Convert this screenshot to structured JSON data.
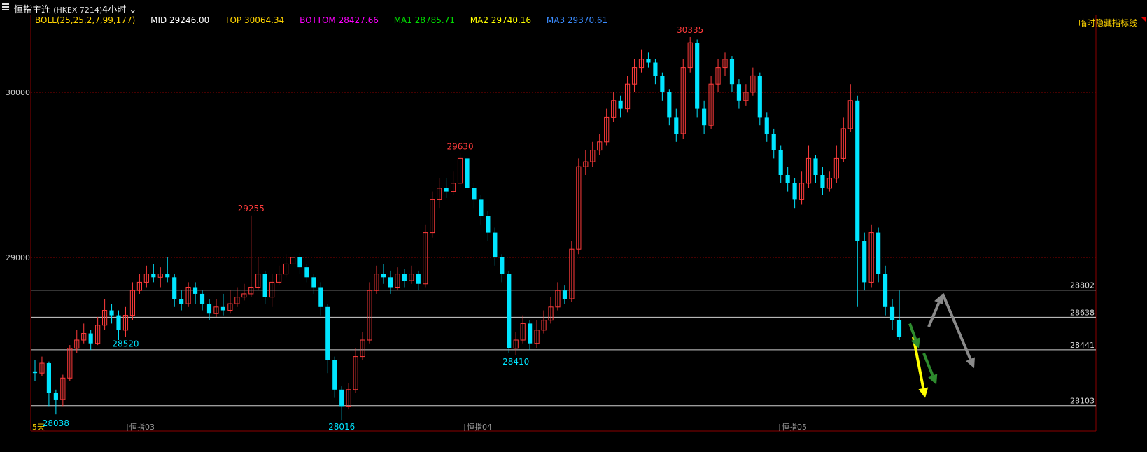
{
  "header": {
    "title": "恒指主连",
    "code": "(HKEX 7214)",
    "period": "4小时"
  },
  "indicator": {
    "boll": "BOLL(25,25,2,7,99,177)",
    "mid": "MID 29246.00",
    "top": "TOP 30064.34",
    "bottom": "BOTTOM 28427.66",
    "ma1": "MA1 28785.71",
    "ma2": "MA2 29740.16",
    "ma3": "MA3 29370.61",
    "hide_label": "临时隐藏指标线",
    "colors": {
      "boll": "#ffd400",
      "mid": "#ffffff",
      "top": "#ffd400",
      "bottom": "#ff00ff",
      "ma1": "#00e000",
      "ma2": "#ffff00",
      "ma3": "#3a8cff"
    }
  },
  "chart_data": {
    "type": "candlestick",
    "y_ticks": [
      29000,
      30000
    ],
    "ylim": [
      28000,
      30450
    ],
    "x_labels": [
      "恒指03",
      "恒指04",
      "恒指05"
    ],
    "bottom_left_label": "5天",
    "grid": "dotted red at y ticks",
    "colors": {
      "up": "#ff3b3b",
      "down": "#00e5ff",
      "grid": "#8b0000",
      "level": "#d0d0d0"
    },
    "annotations": [
      {
        "text": "28038",
        "value": 28038,
        "color": "#00e5ff"
      },
      {
        "text": "29255",
        "value": 29255,
        "color": "#ff3b3b"
      },
      {
        "text": "28016",
        "value": 28016,
        "color": "#00e5ff"
      },
      {
        "text": "29630",
        "value": 29630,
        "color": "#ff3b3b"
      },
      {
        "text": "28410",
        "value": 28410,
        "color": "#00e5ff"
      },
      {
        "text": "30335",
        "value": 30335,
        "color": "#ff3b3b"
      },
      {
        "text": "28520",
        "value": 28520,
        "color": "#00e5ff"
      }
    ],
    "levels": [
      {
        "label": "28802",
        "value": 28802
      },
      {
        "label": "28638",
        "value": 28638
      },
      {
        "label": "28441",
        "value": 28441
      },
      {
        "label": "28103",
        "value": 28103
      }
    ],
    "forecast_arrows": [
      {
        "color": "#ffff00",
        "from": 28520,
        "to": 28150
      },
      {
        "color": "#2e8b2e",
        "from": 28600,
        "to": 28450
      },
      {
        "color": "#2e8b2e",
        "from": 28420,
        "to": 28230
      },
      {
        "color": "#8a8a8a",
        "from": 28580,
        "to": 28780
      },
      {
        "color": "#8a8a8a",
        "from": 28780,
        "to": 28330
      }
    ],
    "candles": [
      [
        28310,
        28300,
        28380,
        28250
      ],
      [
        28300,
        28360,
        28400,
        28280
      ],
      [
        28360,
        28180,
        28370,
        28100
      ],
      [
        28180,
        28140,
        28200,
        28050
      ],
      [
        28140,
        28270,
        28290,
        28100
      ],
      [
        28270,
        28450,
        28470,
        28250
      ],
      [
        28450,
        28500,
        28560,
        28420
      ],
      [
        28500,
        28540,
        28600,
        28480
      ],
      [
        28540,
        28480,
        28560,
        28440
      ],
      [
        28480,
        28590,
        28640,
        28470
      ],
      [
        28590,
        28680,
        28750,
        28560
      ],
      [
        28680,
        28650,
        28720,
        28600
      ],
      [
        28650,
        28560,
        28680,
        28500
      ],
      [
        28560,
        28650,
        28700,
        28520
      ],
      [
        28650,
        28800,
        28850,
        28620
      ],
      [
        28800,
        28850,
        28900,
        28780
      ],
      [
        28850,
        28900,
        28950,
        28820
      ],
      [
        28900,
        28880,
        28960,
        28850
      ],
      [
        28880,
        28900,
        28940,
        28820
      ],
      [
        28900,
        28880,
        29000,
        28850
      ],
      [
        28880,
        28750,
        28900,
        28700
      ],
      [
        28750,
        28720,
        28800,
        28680
      ],
      [
        28720,
        28820,
        28850,
        28700
      ],
      [
        28820,
        28780,
        28850,
        28720
      ],
      [
        28780,
        28720,
        28800,
        28680
      ],
      [
        28720,
        28660,
        28750,
        28620
      ],
      [
        28660,
        28700,
        28750,
        28640
      ],
      [
        28700,
        28680,
        28780,
        28650
      ],
      [
        28680,
        28720,
        28800,
        28660
      ],
      [
        28720,
        28760,
        28820,
        28700
      ],
      [
        28760,
        28780,
        28840,
        28740
      ],
      [
        28780,
        28820,
        29255,
        28760
      ],
      [
        28820,
        28900,
        29000,
        28800
      ],
      [
        28900,
        28760,
        28920,
        28720
      ],
      [
        28760,
        28850,
        28900,
        28700
      ],
      [
        28850,
        28900,
        28950,
        28830
      ],
      [
        28900,
        28960,
        29020,
        28880
      ],
      [
        28960,
        29000,
        29060,
        28920
      ],
      [
        29000,
        28940,
        29030,
        28900
      ],
      [
        28940,
        28880,
        28960,
        28850
      ],
      [
        28880,
        28820,
        28900,
        28780
      ],
      [
        28820,
        28700,
        28850,
        28650
      ],
      [
        28700,
        28380,
        28720,
        28300
      ],
      [
        28380,
        28200,
        28400,
        28150
      ],
      [
        28200,
        28100,
        28220,
        28016
      ],
      [
        28100,
        28200,
        28240,
        28080
      ],
      [
        28200,
        28400,
        28450,
        28180
      ],
      [
        28400,
        28500,
        28550,
        28380
      ],
      [
        28500,
        28800,
        28850,
        28480
      ],
      [
        28800,
        28900,
        28950,
        28780
      ],
      [
        28900,
        28880,
        28960,
        28840
      ],
      [
        28880,
        28820,
        28920,
        28780
      ],
      [
        28820,
        28900,
        28940,
        28800
      ],
      [
        28900,
        28860,
        28930,
        28820
      ],
      [
        28860,
        28900,
        28950,
        28840
      ],
      [
        28900,
        28840,
        28920,
        28800
      ],
      [
        28840,
        29150,
        29200,
        28820
      ],
      [
        29150,
        29350,
        29400,
        29120
      ],
      [
        29350,
        29420,
        29480,
        29300
      ],
      [
        29420,
        29400,
        29480,
        29360
      ],
      [
        29400,
        29450,
        29520,
        29380
      ],
      [
        29450,
        29600,
        29630,
        29420
      ],
      [
        29600,
        29420,
        29620,
        29380
      ],
      [
        29420,
        29350,
        29450,
        29300
      ],
      [
        29350,
        29250,
        29380,
        29200
      ],
      [
        29250,
        29150,
        29280,
        29100
      ],
      [
        29150,
        29000,
        29180,
        28950
      ],
      [
        29000,
        28900,
        29020,
        28850
      ],
      [
        28900,
        28450,
        28920,
        28420
      ],
      [
        28450,
        28500,
        28550,
        28410
      ],
      [
        28500,
        28600,
        28650,
        28480
      ],
      [
        28600,
        28480,
        28620,
        28440
      ],
      [
        28480,
        28560,
        28620,
        28450
      ],
      [
        28560,
        28620,
        28680,
        28540
      ],
      [
        28620,
        28700,
        28760,
        28600
      ],
      [
        28700,
        28800,
        28850,
        28680
      ],
      [
        28800,
        28750,
        28830,
        28720
      ],
      [
        28750,
        29050,
        29100,
        28730
      ],
      [
        29050,
        29550,
        29600,
        29020
      ],
      [
        29550,
        29580,
        29650,
        29500
      ],
      [
        29580,
        29650,
        29700,
        29550
      ],
      [
        29650,
        29700,
        29750,
        29620
      ],
      [
        29700,
        29850,
        29900,
        29680
      ],
      [
        29850,
        29950,
        30000,
        29820
      ],
      [
        29950,
        29900,
        29980,
        29850
      ],
      [
        29900,
        30050,
        30100,
        29880
      ],
      [
        30050,
        30150,
        30200,
        30000
      ],
      [
        30150,
        30200,
        30260,
        30120
      ],
      [
        30200,
        30180,
        30240,
        30150
      ],
      [
        30180,
        30100,
        30200,
        30050
      ],
      [
        30100,
        30000,
        30120,
        29950
      ],
      [
        30000,
        29850,
        30020,
        29800
      ],
      [
        29850,
        29750,
        29900,
        29700
      ],
      [
        29750,
        30150,
        30200,
        29720
      ],
      [
        30150,
        30300,
        30335,
        30120
      ],
      [
        30300,
        29900,
        30320,
        29850
      ],
      [
        29900,
        29800,
        29950,
        29750
      ],
      [
        29800,
        30050,
        30100,
        29780
      ],
      [
        30050,
        30150,
        30200,
        30000
      ],
      [
        30150,
        30200,
        30240,
        30100
      ],
      [
        30200,
        30050,
        30220,
        30000
      ],
      [
        30050,
        29950,
        30080,
        29900
      ],
      [
        29950,
        30000,
        30050,
        29920
      ],
      [
        30000,
        30100,
        30150,
        29980
      ],
      [
        30100,
        29850,
        30120,
        29800
      ],
      [
        29850,
        29750,
        29880,
        29700
      ],
      [
        29750,
        29650,
        29780,
        29600
      ],
      [
        29650,
        29500,
        29680,
        29450
      ],
      [
        29500,
        29450,
        29550,
        29400
      ],
      [
        29450,
        29350,
        29480,
        29300
      ],
      [
        29350,
        29450,
        29520,
        29320
      ],
      [
        29450,
        29600,
        29680,
        29420
      ],
      [
        29600,
        29500,
        29620,
        29450
      ],
      [
        29500,
        29420,
        29550,
        29380
      ],
      [
        29420,
        29480,
        29520,
        29400
      ],
      [
        29480,
        29600,
        29680,
        29450
      ],
      [
        29600,
        29780,
        29850,
        29580
      ],
      [
        29780,
        29950,
        30050,
        29760
      ],
      [
        29950,
        29100,
        29980,
        28700
      ],
      [
        29100,
        28850,
        29150,
        28800
      ],
      [
        28850,
        29150,
        29200,
        28820
      ],
      [
        29150,
        28900,
        29180,
        28850
      ],
      [
        28900,
        28700,
        28950,
        28650
      ],
      [
        28700,
        28620,
        28750,
        28560
      ],
      [
        28620,
        28520,
        28800,
        28500
      ]
    ]
  }
}
